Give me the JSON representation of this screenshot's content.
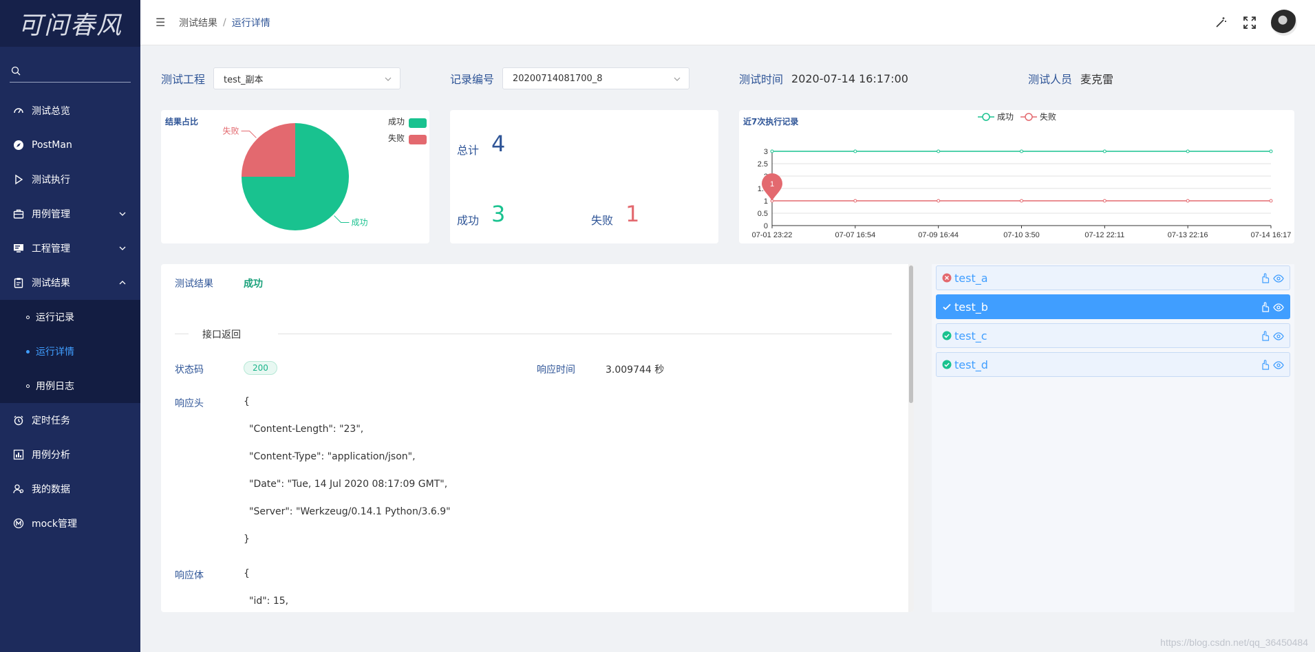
{
  "logo": {
    "text": "可问春风"
  },
  "sidebar": {
    "search_placeholder": "",
    "items": [
      {
        "label": "测试总览",
        "icon": "dashboard-icon"
      },
      {
        "label": "PostMan",
        "icon": "compass-icon"
      },
      {
        "label": "测试执行",
        "icon": "play-icon"
      },
      {
        "label": "用例管理",
        "icon": "briefcase-icon",
        "expandable": true
      },
      {
        "label": "工程管理",
        "icon": "monitor-icon",
        "expandable": true
      },
      {
        "label": "测试结果",
        "icon": "clipboard-icon",
        "expanded": true
      },
      {
        "label": "定时任务",
        "icon": "alarm-icon"
      },
      {
        "label": "用例分析",
        "icon": "chart-icon"
      },
      {
        "label": "我的数据",
        "icon": "user-data-icon"
      },
      {
        "label": "mock管理",
        "icon": "mock-icon"
      }
    ],
    "subitems": [
      {
        "label": "运行记录"
      },
      {
        "label": "运行详情",
        "active": true
      },
      {
        "label": "用例日志"
      }
    ]
  },
  "header": {
    "breadcrumb": [
      "测试结果",
      "运行详情"
    ],
    "separator": "/"
  },
  "filters": {
    "project_label": "测试工程",
    "project_value": "test_副本",
    "record_label": "记录编号",
    "record_value": "20200714081700_8",
    "time_label": "测试时间",
    "time_value": "2020-07-14 16:17:00",
    "tester_label": "测试人员",
    "tester_value": "麦克雷"
  },
  "stats": {
    "total_label": "总计",
    "total_value": "4",
    "success_label": "成功",
    "success_value": "3",
    "fail_label": "失败",
    "fail_value": "1"
  },
  "colors": {
    "success": "#19c28f",
    "fail": "#e3696f",
    "accent": "#409eff",
    "sidebar": "#1d2b5c"
  },
  "pie_chart": {
    "title": "结果占比",
    "legend": [
      "成功",
      "失败"
    ]
  },
  "line_chart": {
    "title": "近7次执行记录",
    "legend": [
      "成功",
      "失败"
    ],
    "marker_value": "1"
  },
  "chart_data": [
    {
      "type": "pie",
      "title": "结果占比",
      "labels": [
        "成功",
        "失败"
      ],
      "values": [
        3,
        1
      ],
      "legend_position": "top-right"
    },
    {
      "type": "line",
      "title": "近7次执行记录",
      "x": [
        "07-01  23:22",
        "07-07  16:54",
        "07-09  16:44",
        "07-10  3:50",
        "07-12  22:11",
        "07-13  22:16",
        "07-14  16:17"
      ],
      "series": [
        {
          "name": "成功",
          "values": [
            3,
            3,
            3,
            3,
            3,
            3,
            3
          ]
        },
        {
          "name": "失败",
          "values": [
            1,
            1,
            1,
            1,
            1,
            1,
            1
          ]
        }
      ],
      "ylim": [
        0,
        3
      ],
      "yticks": [
        "0",
        "0.5",
        "1",
        "1.5",
        "2",
        "2.5",
        "3"
      ],
      "grid": true,
      "legend_position": "top-center"
    }
  ],
  "detail": {
    "result_label": "测试结果",
    "result_value": "成功",
    "section_title": "接口返回",
    "status_label": "状态码",
    "status_value": "200",
    "resp_time_label": "响应时间",
    "resp_time_value": "3.009744 秒",
    "headers_label": "响应头",
    "headers_lines": [
      "{",
      "\"Content-Length\": \"23\",",
      "\"Content-Type\": \"application/json\",",
      "\"Date\": \"Tue, 14 Jul 2020 08:17:09 GMT\",",
      "\"Server\": \"Werkzeug/0.14.1 Python/3.6.9\"",
      "}"
    ],
    "body_label": "响应体",
    "body_lines": [
      "{",
      "\"id\": 15,"
    ]
  },
  "cases": [
    {
      "name": "test_a",
      "status": "fail"
    },
    {
      "name": "test_b",
      "status": "success",
      "active": true
    },
    {
      "name": "test_c",
      "status": "success"
    },
    {
      "name": "test_d",
      "status": "success"
    }
  ],
  "watermark": "https://blog.csdn.net/qq_36450484"
}
